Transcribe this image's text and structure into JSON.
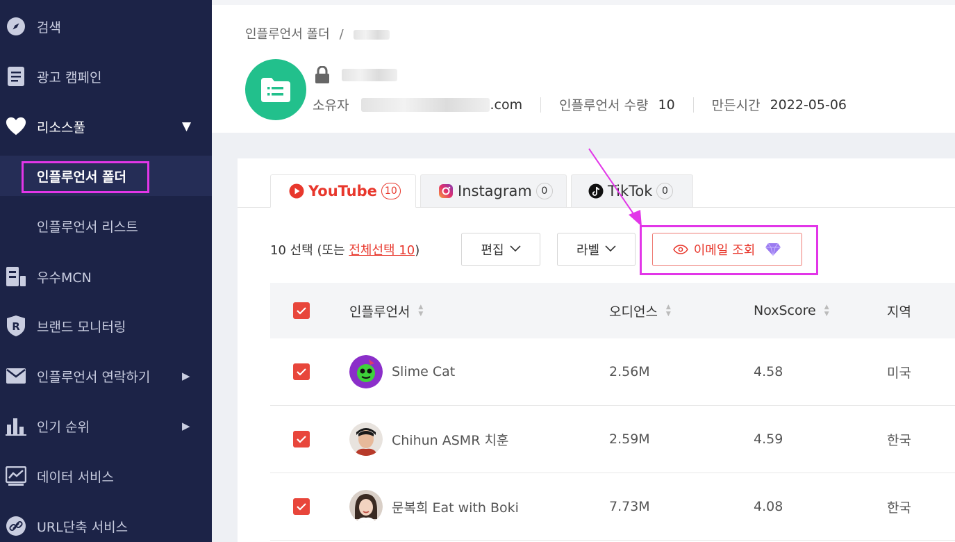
{
  "sidebar": {
    "items": [
      {
        "label": "검색",
        "icon": "compass-icon"
      },
      {
        "label": "광고 캠페인",
        "icon": "document-icon"
      },
      {
        "label": "리소스풀",
        "icon": "heart-icon"
      },
      {
        "label": "인플루언서 폴더"
      },
      {
        "label": "인플루언서 리스트"
      },
      {
        "label": "우수MCN",
        "icon": "building-icon"
      },
      {
        "label": "브랜드 모니터링",
        "icon": "shield-r-icon"
      },
      {
        "label": "인플루언서 연락하기",
        "icon": "mail-icon"
      },
      {
        "label": "인기 순위",
        "icon": "bar-chart-icon"
      },
      {
        "label": "데이터 서비스",
        "icon": "line-chart-icon"
      },
      {
        "label": "URL단축 서비스",
        "icon": "link-icon"
      }
    ]
  },
  "header": {
    "breadcrumb_root": "인플루언서 폴더",
    "breadcrumb_sep": "/",
    "owner_label": "소유자",
    "owner_email_suffix": ".com",
    "count_label": "인플루언서 수량",
    "count_value": "10",
    "created_label": "만든시간",
    "created_value": "2022-05-06"
  },
  "tabs": [
    {
      "label": "YouTube",
      "count": "10",
      "active": true,
      "icon": "youtube-icon"
    },
    {
      "label": "Instagram",
      "count": "0",
      "active": false,
      "icon": "instagram-icon"
    },
    {
      "label": "TikTok",
      "count": "0",
      "active": false,
      "icon": "tiktok-icon"
    }
  ],
  "toolbar": {
    "sel_prefix": "10 선택 (또는 ",
    "sel_link": "전체선택 10",
    "sel_suffix": ")",
    "edit_label": "편집",
    "label_label": "라벨",
    "email_label": "이메일 조회"
  },
  "table": {
    "columns": [
      "인플루언서",
      "오디언스",
      "NoxScore",
      "지역"
    ],
    "rows": [
      {
        "name": "Slime Cat",
        "audience": "2.56M",
        "score": "4.58",
        "region": "미국"
      },
      {
        "name": "Chihun ASMR 치훈",
        "audience": "2.59M",
        "score": "4.59",
        "region": "한국"
      },
      {
        "name": "문복희 Eat with Boki",
        "audience": "7.73M",
        "score": "4.08",
        "region": "한국"
      }
    ]
  },
  "colors": {
    "sidebar_bg": "#1c2347",
    "accent": "#e8372c",
    "highlight": "#e236e8",
    "folder_green": "#22c08c"
  }
}
